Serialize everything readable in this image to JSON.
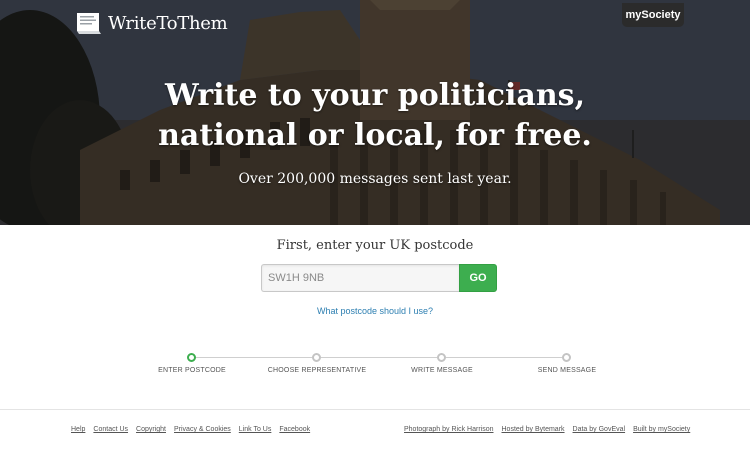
{
  "brand": {
    "logo_text": "WriteToThem",
    "mysociety_label": "mySociety"
  },
  "hero": {
    "headline_line1": "Write to your politicians,",
    "headline_line2": "national or local, for free.",
    "subline": "Over 200,000 messages sent last year."
  },
  "form": {
    "prompt": "First, enter your UK postcode",
    "postcode_placeholder": "SW1H 9NB",
    "go_label": "GO",
    "help_link": "What postcode should I use?"
  },
  "progress": {
    "current_step": 1,
    "steps": [
      {
        "label": "ENTER POSTCODE"
      },
      {
        "label": "CHOOSE REPRESENTATIVE"
      },
      {
        "label": "WRITE MESSAGE"
      },
      {
        "label": "SEND MESSAGE"
      }
    ]
  },
  "footer": {
    "left_links": [
      "Help",
      "Contact Us",
      "Copyright",
      "Privacy & Cookies",
      "Link To Us",
      "Facebook"
    ],
    "right_links": [
      "Photograph by Rick Harrison",
      "Hosted by Bytemark",
      "Data by GovEval",
      "Built by mySociety"
    ]
  },
  "colors": {
    "accent_green": "#3dae4f",
    "link_blue": "#2d7fb1",
    "hero_text": "#ffffff"
  },
  "icons": {
    "logo_mark": "paper-stack-icon"
  }
}
